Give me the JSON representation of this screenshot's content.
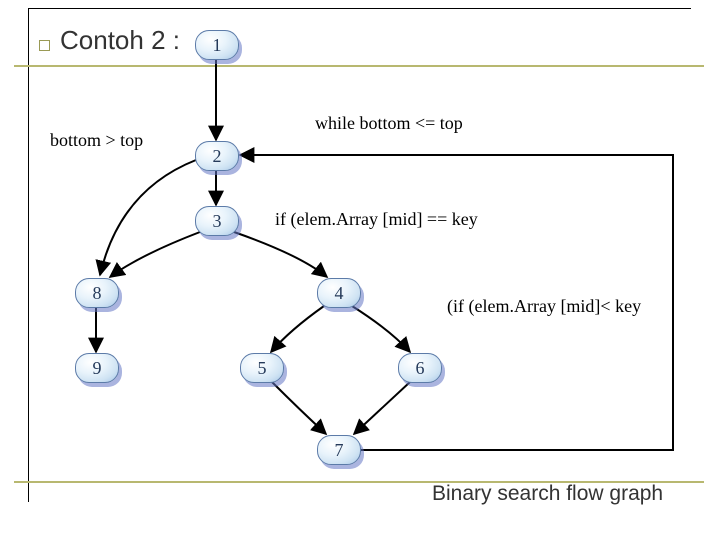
{
  "title": "Contoh 2 :",
  "caption": "Binary search flow graph",
  "nodes": {
    "n1": "1",
    "n2": "2",
    "n3": "3",
    "n4": "4",
    "n5": "5",
    "n6": "6",
    "n7": "7",
    "n8": "8",
    "n9": "9"
  },
  "edge_labels": {
    "while": "while bottom <= top",
    "bottom_gt_top": "bottom > top",
    "if_eq": "if (elem.Array [mid] == key",
    "if_lt": "(if (elem.Array [mid]< key"
  },
  "chart_data": {
    "type": "diagram",
    "title": "Binary search flow graph",
    "nodes": [
      {
        "id": 1
      },
      {
        "id": 2
      },
      {
        "id": 3
      },
      {
        "id": 4
      },
      {
        "id": 5
      },
      {
        "id": 6
      },
      {
        "id": 7
      },
      {
        "id": 8
      },
      {
        "id": 9
      }
    ],
    "edges": [
      {
        "from": 1,
        "to": 2
      },
      {
        "from": 2,
        "to": 3,
        "label": "while bottom <= top"
      },
      {
        "from": 2,
        "to": 8,
        "label": "bottom > top"
      },
      {
        "from": 3,
        "to": 8,
        "label": "if (elem.Array [mid] == key"
      },
      {
        "from": 3,
        "to": 4
      },
      {
        "from": 4,
        "to": 5,
        "label": "(if (elem.Array [mid]< key"
      },
      {
        "from": 4,
        "to": 6
      },
      {
        "from": 5,
        "to": 7
      },
      {
        "from": 6,
        "to": 7
      },
      {
        "from": 7,
        "to": 2
      },
      {
        "from": 8,
        "to": 9
      }
    ]
  }
}
